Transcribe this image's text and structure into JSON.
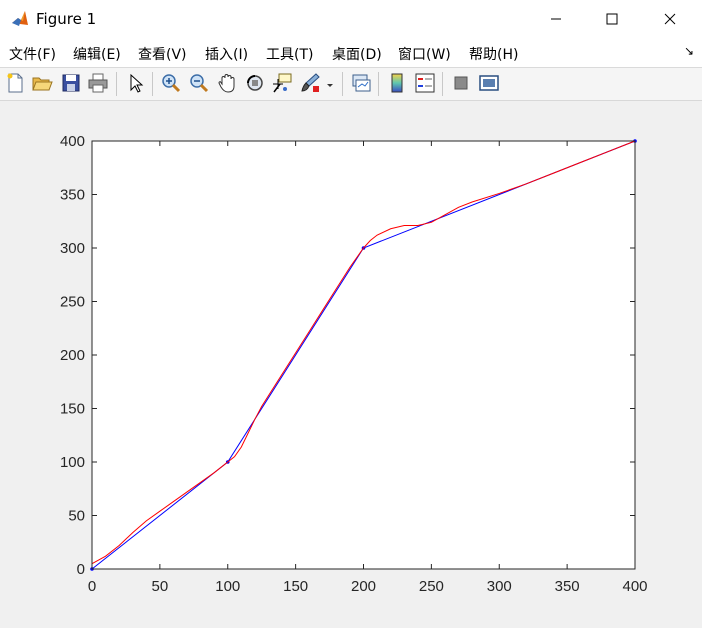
{
  "window": {
    "title": "Figure 1",
    "controls": {
      "minimize": "—",
      "maximize": "☐",
      "close": "✕"
    }
  },
  "menu": {
    "items": [
      "文件(F)",
      "编辑(E)",
      "查看(V)",
      "插入(I)",
      "工具(T)",
      "桌面(D)",
      "窗口(W)",
      "帮助(H)"
    ],
    "overflow_glyph": "↘"
  },
  "toolbar": {
    "buttons": [
      "new-figure-icon",
      "open-file-icon",
      "save-icon",
      "print-icon",
      "edit-plot-arrow-icon",
      "zoom-in-icon",
      "zoom-out-icon",
      "pan-hand-icon",
      "rotate-3d-icon",
      "data-cursor-icon",
      "brush-icon",
      "link-plot-icon",
      "colorbar-icon",
      "legend-icon",
      "hide-plot-tools-icon",
      "show-plot-tools-icon"
    ]
  },
  "colors": {
    "series_blue": "#0000ff",
    "series_red": "#ff0000",
    "axes_bg": "#ffffff",
    "figure_bg": "#f0f0f0"
  },
  "chart_data": {
    "type": "line",
    "title": "",
    "xlabel": "",
    "ylabel": "",
    "xlim": [
      0,
      400
    ],
    "ylim": [
      0,
      400
    ],
    "xticks": [
      0,
      50,
      100,
      150,
      200,
      250,
      300,
      350,
      400
    ],
    "yticks": [
      0,
      50,
      100,
      150,
      200,
      250,
      300,
      350,
      400
    ],
    "grid": false,
    "box": true,
    "series": [
      {
        "color": "#0000ff",
        "marker": "dot",
        "x": [
          0,
          100,
          200,
          400
        ],
        "y": [
          0,
          100,
          300,
          400
        ]
      },
      {
        "color": "#ff0000",
        "marker": "none",
        "x": [
          0,
          10,
          20,
          30,
          40,
          50,
          60,
          70,
          80,
          90,
          100,
          105,
          110,
          115,
          120,
          125,
          130,
          140,
          150,
          160,
          170,
          180,
          190,
          200,
          205,
          210,
          220,
          230,
          240,
          250,
          260,
          270,
          280,
          300,
          320,
          340,
          360,
          380,
          400
        ],
        "y": [
          5,
          12,
          22,
          34,
          45,
          54,
          63,
          72,
          81,
          90,
          100,
          105,
          114,
          127,
          140,
          152,
          162,
          182,
          202,
          222,
          242,
          262,
          282,
          300,
          307,
          312,
          318,
          321,
          321,
          324,
          331,
          338,
          343,
          351,
          360,
          370,
          380,
          390,
          400
        ]
      }
    ]
  }
}
